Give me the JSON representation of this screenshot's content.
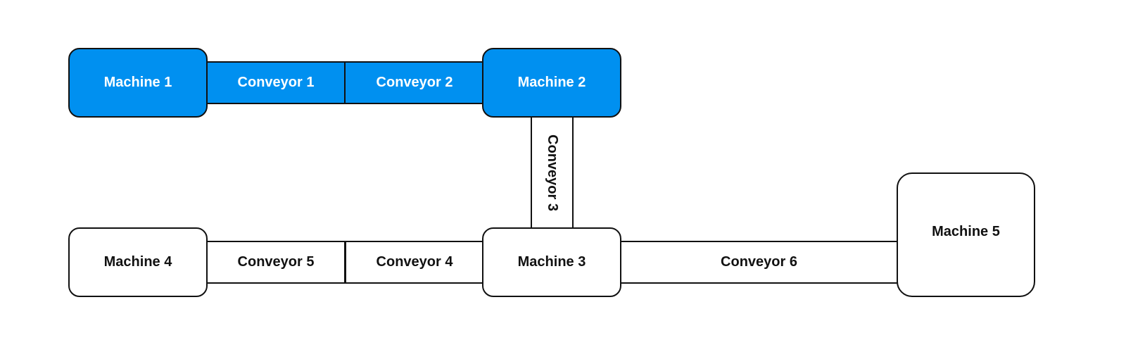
{
  "highlight_color": "#0090f0",
  "machines": [
    {
      "label": "Machine 1",
      "highlighted": true
    },
    {
      "label": "Machine 2",
      "highlighted": true
    },
    {
      "label": "Machine 3",
      "highlighted": false
    },
    {
      "label": "Machine 4",
      "highlighted": false
    },
    {
      "label": "Machine 5",
      "highlighted": false
    }
  ],
  "conveyors": [
    {
      "label": "Conveyor 1",
      "highlighted": true
    },
    {
      "label": "Conveyor 2",
      "highlighted": true
    },
    {
      "label": "Conveyor 3",
      "highlighted": false
    },
    {
      "label": "Conveyor 4",
      "highlighted": false
    },
    {
      "label": "Conveyor 5",
      "highlighted": false
    },
    {
      "label": "Conveyor 6",
      "highlighted": false
    }
  ]
}
